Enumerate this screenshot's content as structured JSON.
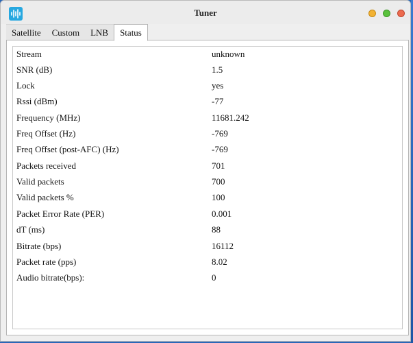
{
  "window": {
    "title": "Tuner"
  },
  "tabs": [
    {
      "label": "Satellite"
    },
    {
      "label": "Custom"
    },
    {
      "label": "LNB"
    },
    {
      "label": "Status"
    }
  ],
  "active_tab": "Status",
  "status": {
    "rows": [
      {
        "label": "Stream",
        "value": "unknown"
      },
      {
        "label": "SNR (dB)",
        "value": "1.5"
      },
      {
        "label": "Lock",
        "value": "yes"
      },
      {
        "label": "Rssi (dBm)",
        "value": "-77"
      },
      {
        "label": "Frequency (MHz)",
        "value": "11681.242"
      },
      {
        "label": "Freq Offset (Hz)",
        "value": "-769"
      },
      {
        "label": "Freq Offset (post-AFC) (Hz)",
        "value": "-769"
      },
      {
        "label": "Packets received",
        "value": "701"
      },
      {
        "label": "Valid packets",
        "value": "700"
      },
      {
        "label": "Valid packets %",
        "value": "100"
      },
      {
        "label": "Packet Error Rate (PER)",
        "value": "0.001"
      },
      {
        "label": "dT (ms)",
        "value": "88"
      },
      {
        "label": "Bitrate (bps)",
        "value": "16112"
      },
      {
        "label": "Packet rate (pps)",
        "value": "8.02"
      },
      {
        "label": "Audio bitrate(bps):",
        "value": "0"
      }
    ]
  },
  "colors": {
    "app_icon": "#27a8e0",
    "minimize": "#f2b233",
    "maximize": "#59c13c",
    "close": "#ec6b4f",
    "desktop": "#2a67b8"
  },
  "icons": {
    "app": "audio-waveform-icon",
    "minimize": "minimize-button",
    "maximize": "maximize-button",
    "close": "close-button"
  }
}
